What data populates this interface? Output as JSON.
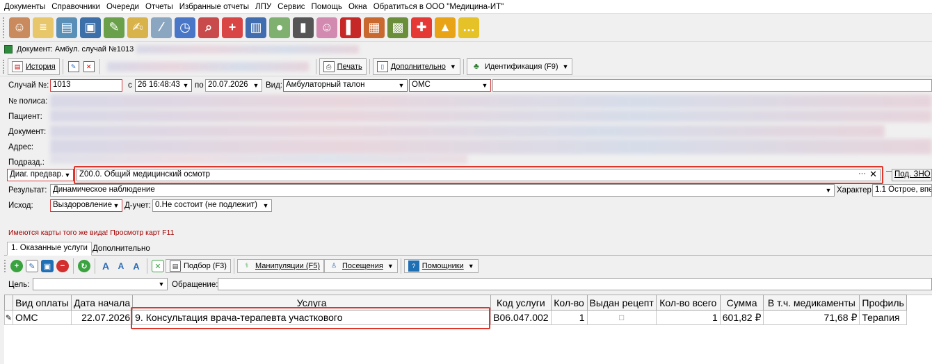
{
  "menu": [
    "Документы",
    "Справочники",
    "Очереди",
    "Отчеты",
    "Избранные отчеты",
    "ЛПУ",
    "Сервис",
    "Помощь",
    "Окна",
    "Обратиться в ООО \"Медицина-ИТ\""
  ],
  "toolbar_icons": [
    {
      "icon": "doctor-icon",
      "color": "#c98b5e",
      "glyph": "☺"
    },
    {
      "icon": "notepad-icon",
      "color": "#e8c66a",
      "glyph": "≡"
    },
    {
      "icon": "cabinet-icon",
      "color": "#5a8fb8",
      "glyph": "▤"
    },
    {
      "icon": "card-icon",
      "color": "#3d6fa8",
      "glyph": "▣"
    },
    {
      "icon": "book-pencil-icon",
      "color": "#6aa04a",
      "glyph": "✎"
    },
    {
      "icon": "edit-icon",
      "color": "#d8b24a",
      "glyph": "✍"
    },
    {
      "icon": "syringe-icon",
      "color": "#8aa6c0",
      "glyph": "⁄"
    },
    {
      "icon": "schedule-icon",
      "color": "#4a76c8",
      "glyph": "◷"
    },
    {
      "icon": "search-doc-icon",
      "color": "#c84a4a",
      "glyph": "⌕"
    },
    {
      "icon": "first-aid-icon",
      "color": "#d94444",
      "glyph": "+"
    },
    {
      "icon": "books-icon",
      "color": "#3f6db0",
      "glyph": "▥"
    },
    {
      "icon": "pills-icon",
      "color": "#7fb070",
      "glyph": "●"
    },
    {
      "icon": "barcode-scanner-icon",
      "color": "#555555",
      "glyph": "▮"
    },
    {
      "icon": "nurse-icon",
      "color": "#d38ab0",
      "glyph": "☺"
    },
    {
      "icon": "red-book-icon",
      "color": "#c62828",
      "glyph": "▌"
    },
    {
      "icon": "calendar-icon",
      "color": "#c9682f",
      "glyph": "▦"
    },
    {
      "icon": "calculator-icon",
      "color": "#6b8e3a",
      "glyph": "▩"
    },
    {
      "icon": "lifebuoy-icon",
      "color": "#e53935",
      "glyph": "✚"
    },
    {
      "icon": "lock-icon",
      "color": "#e8a317",
      "glyph": "▲"
    },
    {
      "icon": "chat-icon",
      "color": "#e6c229",
      "glyph": "…"
    }
  ],
  "document_title": "Документ: Амбул. случай №1013",
  "toolbar2": {
    "history": "История",
    "print": "Печать",
    "additional": "Дополнительно",
    "identification": "Идентификация (F9)"
  },
  "form": {
    "case_label": "Случай №:",
    "case_number": "1013",
    "from_label": "с",
    "from_value": "26 16:48:43",
    "to_label": "по",
    "to_value": "20.07.2026",
    "kind_label": "Вид:",
    "kind_value": "Амбулаторный талон",
    "payment_value": "ОМС",
    "policy_label": "№ полиса:",
    "patient_label": "Пациент:",
    "document_label": "Документ:",
    "address_label": "Адрес:",
    "subdivision_label": "Подразд.:",
    "diag_type": "Диаг. предвар.",
    "diag_value": "Z00.0. Общий медицинский осмотр",
    "zno_label": "Под. ЗНО",
    "result_label": "Результат:",
    "result_value": "Динамическое наблюдение",
    "character_label": "Характер:",
    "character_value": "1.1 Острое, впе",
    "outcome_label": "Исход:",
    "outcome_value": "Выздоровление",
    "d_account_label": "Д-учет:",
    "d_account_value": "0.Не состоит (не подлежит)",
    "warning": "Имеются карты того же вида! Просмотр карт F11"
  },
  "tabs": [
    "1. Оказанные услуги",
    "Дополнительно"
  ],
  "toolbar3": {
    "selection": "Подбор (F3)",
    "manipulations": "Манипуляции (F5)",
    "visits": "Посещения",
    "helpers": "Помощники"
  },
  "filters": {
    "goal_label": "Цель:",
    "appeal_label": "Обращение:"
  },
  "table": {
    "headers": [
      "Вид оплаты",
      "Дата начала",
      "Услуга",
      "Код услуги",
      "Кол-во",
      "Выдан рецепт",
      "Кол-во всего",
      "Сумма",
      "В т.ч. медикаменты",
      "Профиль"
    ],
    "rows": [
      {
        "payment": "ОМС",
        "date": "22.07.2026",
        "service": "9. Консультация врача-терапевта участкового",
        "code": "В06.047.002",
        "qty": "1",
        "recipe": "□",
        "qty_total": "1",
        "sum": "601,82 ₽",
        "medicines": "71,68 ₽",
        "profile": "Терапия"
      }
    ]
  }
}
